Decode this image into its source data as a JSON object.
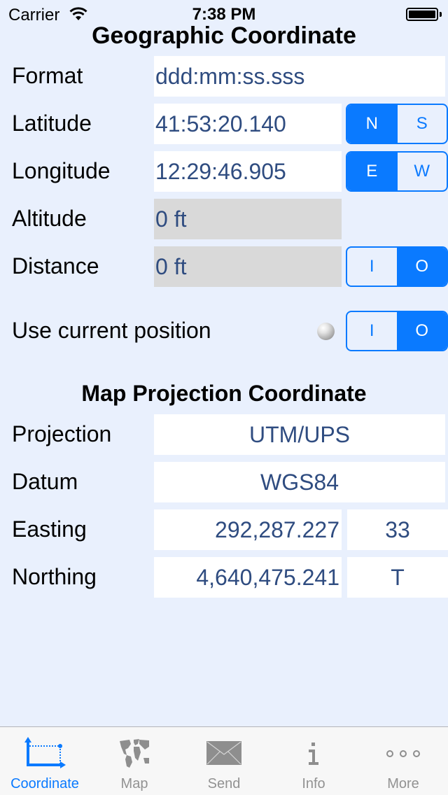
{
  "status_bar": {
    "carrier": "Carrier",
    "time": "7:38 PM",
    "wifi_icon": "wifi-icon",
    "battery_icon": "battery-full-icon"
  },
  "geographic": {
    "title": "Geographic Coordinate",
    "format": {
      "label": "Format",
      "value": "ddd:mm:ss.sss"
    },
    "latitude": {
      "label": "Latitude",
      "value": "41:53:20.140",
      "hemisphere": {
        "options": [
          "N",
          "S"
        ],
        "selected": "N"
      }
    },
    "longitude": {
      "label": "Longitude",
      "value": "12:29:46.905",
      "hemisphere": {
        "options": [
          "E",
          "W"
        ],
        "selected": "E"
      }
    },
    "altitude": {
      "label": "Altitude",
      "value": "0 ft"
    },
    "distance": {
      "label": "Distance",
      "value": "0 ft",
      "toggle": {
        "options": [
          "I",
          "O"
        ],
        "selected": "O"
      }
    },
    "use_current_position": {
      "label": "Use current position",
      "indicator_icon": "gps-status-indicator",
      "toggle": {
        "options": [
          "I",
          "O"
        ],
        "selected": "O"
      }
    }
  },
  "map_projection": {
    "title": "Map Projection Coordinate",
    "projection": {
      "label": "Projection",
      "value": "UTM/UPS"
    },
    "datum": {
      "label": "Datum",
      "value": "WGS84"
    },
    "easting": {
      "label": "Easting",
      "value": "292,287.227",
      "zone": "33"
    },
    "northing": {
      "label": "Northing",
      "value": "4,640,475.241",
      "band": "T"
    }
  },
  "tab_bar": {
    "active": "Coordinate",
    "tabs": [
      {
        "label": "Coordinate",
        "icon": "coordinate-axes-icon"
      },
      {
        "label": "Map",
        "icon": "world-map-icon"
      },
      {
        "label": "Send",
        "icon": "envelope-icon"
      },
      {
        "label": "Info",
        "icon": "info-icon"
      },
      {
        "label": "More",
        "icon": "more-icon"
      }
    ]
  },
  "colors": {
    "background": "#e9f0fd",
    "accent": "#0a7aff",
    "value_text": "#2f4c80",
    "disabled_field": "#d9d9d9",
    "tab_inactive": "#929292"
  }
}
